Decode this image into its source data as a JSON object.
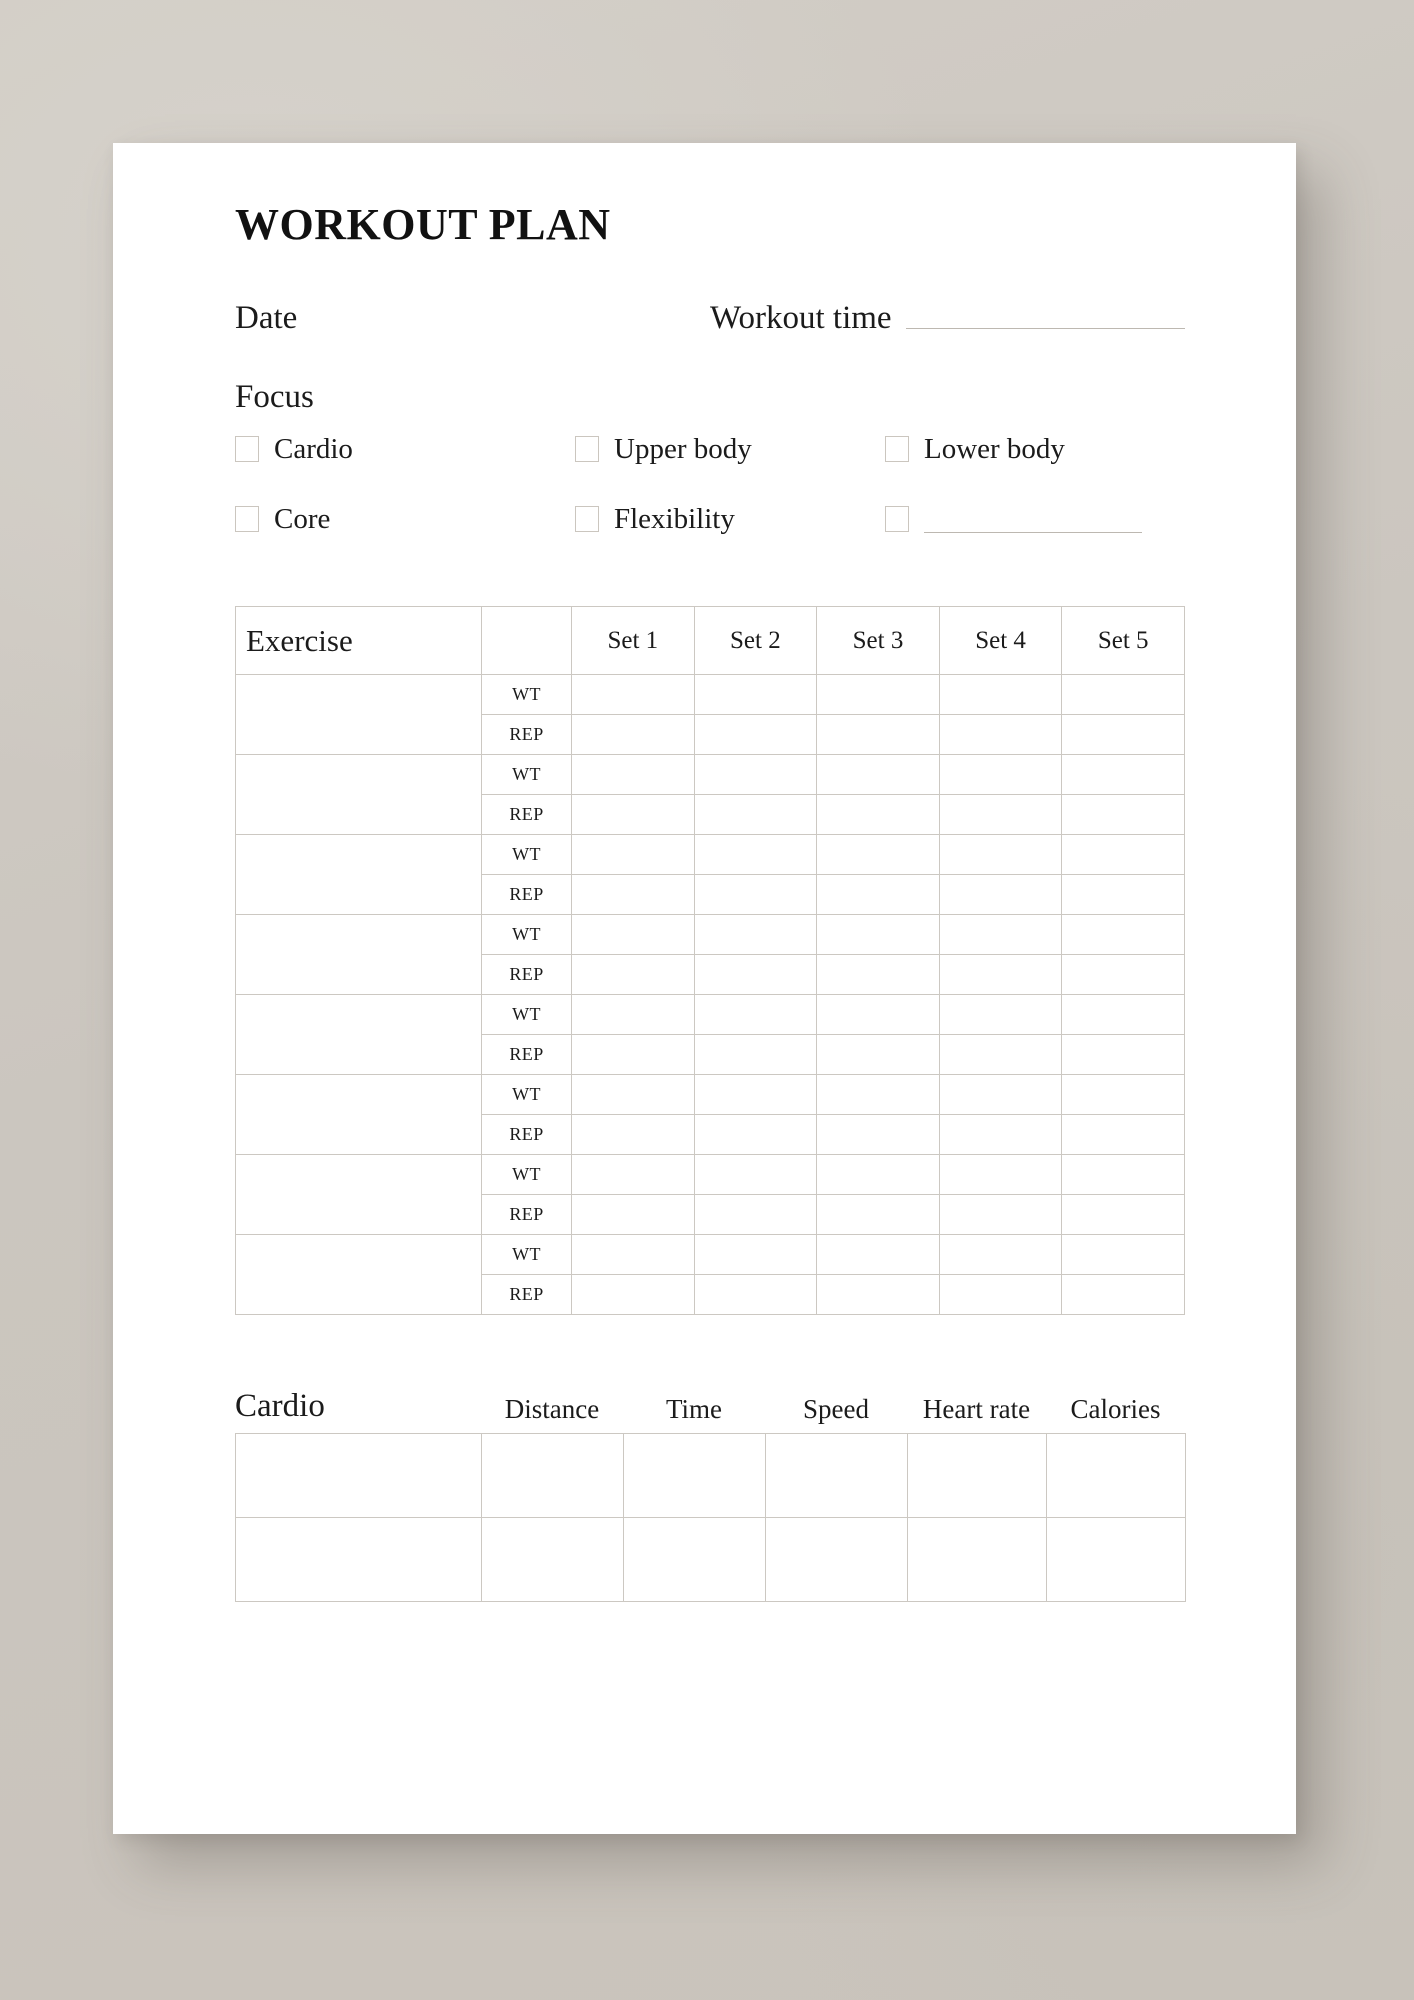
{
  "page": {
    "title": "WORKOUT PLAN",
    "background_color": "#cbc6bf",
    "paper_color": "#ffffff",
    "line_color": "#bdb8b1",
    "ring_color": "#d9d6cf"
  },
  "meta": {
    "date_label": "Date",
    "workout_time_label": "Workout time"
  },
  "focus": {
    "heading": "Focus",
    "options": [
      {
        "label": "Cardio",
        "has_write_in_line": false
      },
      {
        "label": "Upper body",
        "has_write_in_line": false
      },
      {
        "label": "Lower body",
        "has_write_in_line": false
      },
      {
        "label": "Core",
        "has_write_in_line": false
      },
      {
        "label": "Flexibility",
        "has_write_in_line": false
      },
      {
        "label": "",
        "has_write_in_line": true
      }
    ]
  },
  "exercise_table": {
    "name_header": "Exercise",
    "unit_header": "",
    "set_headers": [
      "Set 1",
      "Set 2",
      "Set 3",
      "Set 4",
      "Set 5"
    ],
    "unit_labels": [
      "WT",
      "REP"
    ],
    "row_count": 8,
    "rows": [
      {
        "name": "",
        "wt": [
          "",
          "",
          "",
          "",
          ""
        ],
        "rep": [
          "",
          "",
          "",
          "",
          ""
        ]
      },
      {
        "name": "",
        "wt": [
          "",
          "",
          "",
          "",
          ""
        ],
        "rep": [
          "",
          "",
          "",
          "",
          ""
        ]
      },
      {
        "name": "",
        "wt": [
          "",
          "",
          "",
          "",
          ""
        ],
        "rep": [
          "",
          "",
          "",
          "",
          ""
        ]
      },
      {
        "name": "",
        "wt": [
          "",
          "",
          "",
          "",
          ""
        ],
        "rep": [
          "",
          "",
          "",
          "",
          ""
        ]
      },
      {
        "name": "",
        "wt": [
          "",
          "",
          "",
          "",
          ""
        ],
        "rep": [
          "",
          "",
          "",
          "",
          ""
        ]
      },
      {
        "name": "",
        "wt": [
          "",
          "",
          "",
          "",
          ""
        ],
        "rep": [
          "",
          "",
          "",
          "",
          ""
        ]
      },
      {
        "name": "",
        "wt": [
          "",
          "",
          "",
          "",
          ""
        ],
        "rep": [
          "",
          "",
          "",
          "",
          ""
        ]
      },
      {
        "name": "",
        "wt": [
          "",
          "",
          "",
          "",
          ""
        ],
        "rep": [
          "",
          "",
          "",
          "",
          ""
        ]
      }
    ]
  },
  "cardio_table": {
    "title": "Cardio",
    "headers": [
      "Distance",
      "Time",
      "Speed",
      "Heart rate",
      "Calories"
    ],
    "rows": [
      {
        "name": "",
        "values": [
          "",
          "",
          "",
          "",
          ""
        ]
      },
      {
        "name": "",
        "values": [
          "",
          "",
          "",
          "",
          ""
        ]
      }
    ]
  },
  "decor": {
    "signature_number": "6.13",
    "ring_count": 6
  }
}
